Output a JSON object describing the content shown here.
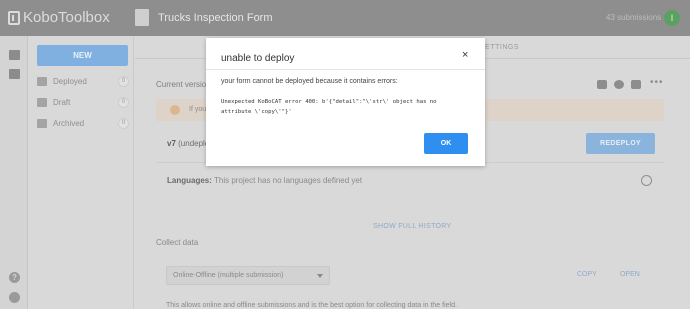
{
  "app": {
    "logo_text": "KoboToolbox"
  },
  "header": {
    "form_title": "Trucks Inspection Form",
    "submissions": "43 submissions",
    "avatar_initial": "I"
  },
  "sidebar": {
    "new_label": "NEW",
    "items": [
      {
        "label": "Deployed",
        "count": "0",
        "icon": "rocket-icon"
      },
      {
        "label": "Draft",
        "count": "0",
        "icon": "draft-icon"
      },
      {
        "label": "Archived",
        "count": "0",
        "icon": "archive-icon"
      }
    ]
  },
  "main": {
    "tab_settings": "SETTINGS",
    "current_version_label": "Current version",
    "warning_text": "If you",
    "version_label": "v7",
    "version_status": "(undeploy",
    "redeploy_label": "REDEPLOY",
    "languages_label": "Languages:",
    "languages_value": "This project has no languages defined yet",
    "show_history": "SHOW FULL HISTORY",
    "collect_label": "Collect data",
    "collect_select": "Online-Offline (multiple submission)",
    "copy_label": "COPY",
    "open_label": "OPEN",
    "collect_desc": "This allows online and offline submissions and is the best option for collecting data in the field."
  },
  "modal": {
    "title": "unable to deploy",
    "close": "×",
    "message": "your form cannot be deployed because it contains errors:",
    "error_line1": "Unexpected KoBoCAT error 400: b'{\"detail\":\"\\'str\\' object has no",
    "error_line2": "attribute \\'copy\\'\"}'",
    "ok_label": "OK"
  },
  "colors": {
    "topbar": "#8e8e8e",
    "primary": "#2f8ff0",
    "avatar": "#5aa05f",
    "overlay_bg": "#d9d9d9"
  }
}
